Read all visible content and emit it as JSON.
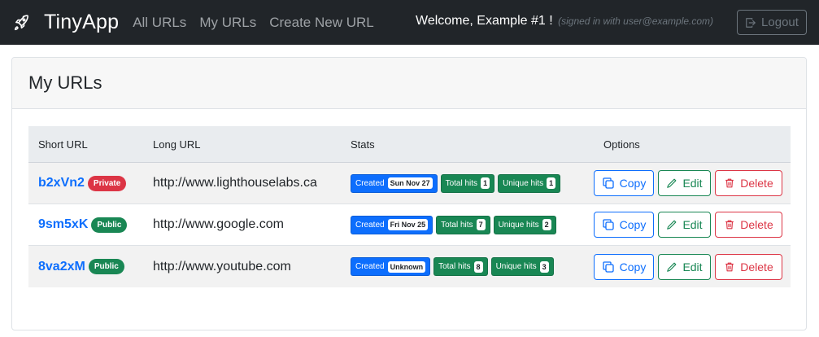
{
  "navbar": {
    "brand": "TinyApp",
    "links": [
      "All URLs",
      "My URLs",
      "Create New URL"
    ],
    "welcome_prefix": "Welcome, ",
    "welcome_name": "Example #1",
    "welcome_suffix": " !",
    "signed_in_text": "(signed in with user@example.com)",
    "logout_label": "Logout"
  },
  "page": {
    "title": "My URLs"
  },
  "table": {
    "headers": [
      "Short URL",
      "Long URL",
      "Stats",
      "Options"
    ],
    "rows": [
      {
        "short": "b2xVn2",
        "visibility": "Private",
        "long": "http://www.lighthouselabs.ca",
        "created_label": "Created",
        "created": "Sun Nov 27",
        "total_label": "Total hits",
        "total": "1",
        "unique_label": "Unique hits",
        "unique": "1"
      },
      {
        "short": "9sm5xK",
        "visibility": "Public",
        "long": "http://www.google.com",
        "created_label": "Created",
        "created": "Fri Nov 25",
        "total_label": "Total hits",
        "total": "7",
        "unique_label": "Unique hits",
        "unique": "2"
      },
      {
        "short": "8va2xM",
        "visibility": "Public",
        "long": "http://www.youtube.com",
        "created_label": "Created",
        "created": "Unknown",
        "total_label": "Total hits",
        "total": "8",
        "unique_label": "Unique hits",
        "unique": "3"
      }
    ],
    "options": {
      "copy_label": "Copy",
      "edit_label": "Edit",
      "delete_label": "Delete"
    }
  },
  "colors": {
    "navbar_bg": "#212529",
    "primary": "#0d6efd",
    "success": "#198754",
    "danger": "#dc3545"
  }
}
